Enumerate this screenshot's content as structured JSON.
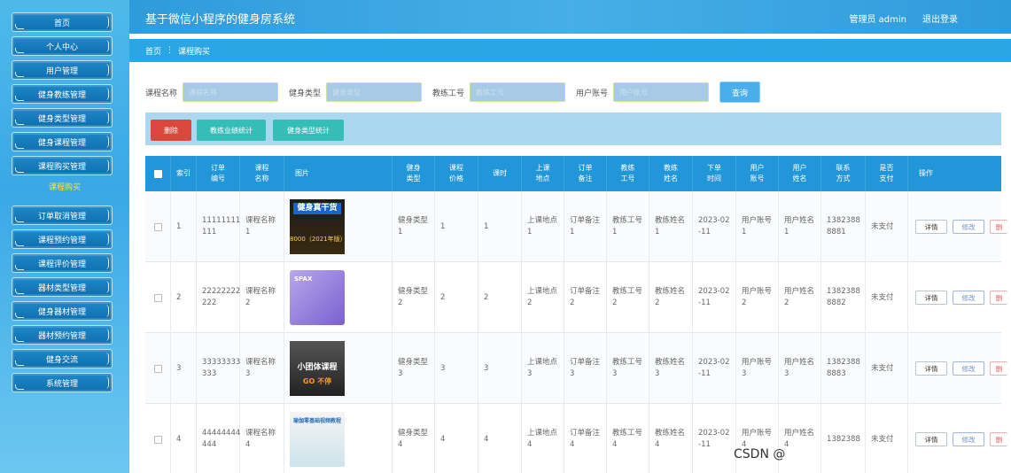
{
  "app": {
    "title": "基于微信小程序的健身房系统",
    "admin_label": "管理员 admin",
    "logout": "退出登录"
  },
  "sidebar": {
    "items": [
      "首页",
      "个人中心",
      "用户管理",
      "健身教练管理",
      "健身类型管理",
      "健身课程管理",
      "课程购买管理",
      "订单取消管理",
      "课程预约管理",
      "课程评价管理",
      "器材类型管理",
      "健身器材管理",
      "器材预约管理",
      "健身交流",
      "系统管理"
    ],
    "sub_item": "课程购买"
  },
  "breadcrumb": {
    "home": "首页",
    "sep": "⋮",
    "current": "课程购买"
  },
  "search": {
    "fields": [
      {
        "label": "课程名称",
        "placeholder": "课程名称"
      },
      {
        "label": "健身类型",
        "placeholder": "健身类型"
      },
      {
        "label": "教练工号",
        "placeholder": "教练工号"
      },
      {
        "label": "用户账号",
        "placeholder": "用户账号"
      }
    ],
    "button": "查询"
  },
  "toolbar": {
    "delete": "删除",
    "stat1": "教练业绩统计",
    "stat2": "健身类型统计"
  },
  "table": {
    "headers": [
      "索引",
      "订单编号",
      "课程名称",
      "图片",
      "健身类型",
      "课程价格",
      "课时",
      "上课地点",
      "订单备注",
      "教练工号",
      "教练姓名",
      "下单时间",
      "用户账号",
      "用户姓名",
      "联系方式",
      "是否支付",
      "操作"
    ],
    "headers_display": [
      [
        "索",
        "引"
      ],
      [
        "订单",
        "编号"
      ],
      [
        "课程",
        "名称"
      ],
      [
        "图片"
      ],
      [
        "健身",
        "类型"
      ],
      [
        "课程",
        "价格"
      ],
      [
        "课时"
      ],
      [
        "上课",
        "地点"
      ],
      [
        "订单",
        "备注"
      ],
      [
        "教练",
        "工号"
      ],
      [
        "教练",
        "姓名"
      ],
      [
        "下单",
        "时间"
      ],
      [
        "用户",
        "账号"
      ],
      [
        "用户",
        "姓名"
      ],
      [
        "联系",
        "方式"
      ],
      [
        "是否",
        "支付"
      ],
      [
        "操作"
      ]
    ],
    "rows": [
      {
        "idx": "1",
        "order_no": [
          "11111111",
          "111"
        ],
        "course": [
          "课程名称",
          "1"
        ],
        "img_top": "健身真干货",
        "img_bottom": "8000（2021年版）",
        "type": [
          "健身类型",
          "1"
        ],
        "price": "1",
        "hours": "1",
        "place": [
          "上课地点",
          "1"
        ],
        "note": [
          "订单备注",
          "1"
        ],
        "coach_no": [
          "教练工号",
          "1"
        ],
        "coach_name": [
          "教练姓名",
          "1"
        ],
        "time": [
          "2023-02",
          "-11"
        ],
        "user_acc": [
          "用户账号",
          "1"
        ],
        "user_name": [
          "用户姓名",
          "1"
        ],
        "phone": [
          "1382388",
          "8881"
        ],
        "paid": "未支付"
      },
      {
        "idx": "2",
        "order_no": [
          "22222222",
          "222"
        ],
        "course": [
          "课程名称",
          "2"
        ],
        "img_top": "SPAX",
        "img_bottom": "",
        "type": [
          "健身类型",
          "2"
        ],
        "price": "2",
        "hours": "2",
        "place": [
          "上课地点",
          "2"
        ],
        "note": [
          "订单备注",
          "2"
        ],
        "coach_no": [
          "教练工号",
          "2"
        ],
        "coach_name": [
          "教练姓名",
          "2"
        ],
        "time": [
          "2023-02",
          "-11"
        ],
        "user_acc": [
          "用户账号",
          "2"
        ],
        "user_name": [
          "用户姓名",
          "2"
        ],
        "phone": [
          "1382388",
          "8882"
        ],
        "paid": "未支付"
      },
      {
        "idx": "3",
        "order_no": [
          "33333333",
          "333"
        ],
        "course": [
          "课程名称",
          "3"
        ],
        "img_top": "小团体课程",
        "img_bottom": "GO 不停",
        "type": [
          "健身类型",
          "3"
        ],
        "price": "3",
        "hours": "3",
        "place": [
          "上课地点",
          "3"
        ],
        "note": [
          "订单备注",
          "3"
        ],
        "coach_no": [
          "教练工号",
          "3"
        ],
        "coach_name": [
          "教练姓名",
          "3"
        ],
        "time": [
          "2023-02",
          "-11"
        ],
        "user_acc": [
          "用户账号",
          "3"
        ],
        "user_name": [
          "用户姓名",
          "3"
        ],
        "phone": [
          "1382388",
          "8883"
        ],
        "paid": "未支付"
      },
      {
        "idx": "4",
        "order_no": [
          "44444444",
          "444"
        ],
        "course": [
          "课程名称",
          "4"
        ],
        "img_top": "瑜伽零基础视频教程",
        "img_bottom": "",
        "type": [
          "健身类型",
          "4"
        ],
        "price": "4",
        "hours": "4",
        "place": [
          "上课地点",
          "4"
        ],
        "note": [
          "订单备注",
          "4"
        ],
        "coach_no": [
          "教练工号",
          "4"
        ],
        "coach_name": [
          "教练姓名",
          "4"
        ],
        "time": [
          "2023-02",
          "-11"
        ],
        "user_acc": [
          "用户账号",
          "4"
        ],
        "user_name": [
          "用户姓名",
          "4"
        ],
        "phone": [
          "1382388",
          ""
        ],
        "paid": "未支付"
      }
    ],
    "actions": {
      "detail": "详情",
      "edit": "修改",
      "delete": "删"
    }
  },
  "watermark": "CSDN @"
}
